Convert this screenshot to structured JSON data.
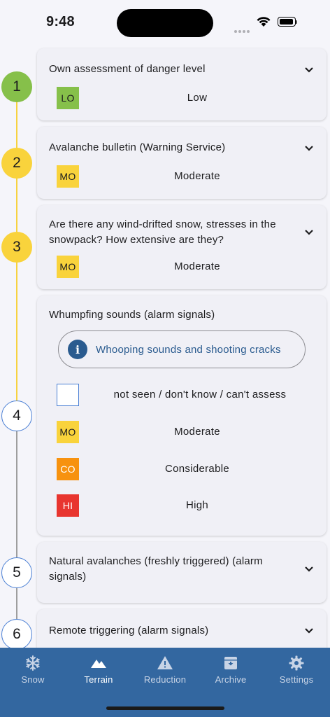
{
  "status": {
    "time": "9:48"
  },
  "steps": [
    "1",
    "2",
    "3",
    "4",
    "5",
    "6"
  ],
  "cards": {
    "c1": {
      "title": "Own assessment of danger level",
      "code": "LO",
      "level": "Low"
    },
    "c2": {
      "title": "Avalanche bulletin (Warning Service)",
      "code": "MO",
      "level": "Moderate"
    },
    "c3": {
      "title": "Are there any wind-drifted snow, stresses in the snowpack? How extensive are they?",
      "code": "MO",
      "level": "Moderate"
    },
    "c4": {
      "title": "Whumpfing sounds (alarm signals)",
      "info": "Whooping sounds and shooting cracks",
      "options": [
        {
          "code": "",
          "label": "not seen / don't know / can't assess"
        },
        {
          "code": "MO",
          "label": "Moderate"
        },
        {
          "code": "CO",
          "label": "Considerable"
        },
        {
          "code": "HI",
          "label": "High"
        }
      ]
    },
    "c5": {
      "title": "Natural avalanches (freshly triggered) (alarm signals)"
    },
    "c6": {
      "title": "Remote triggering (alarm signals)"
    }
  },
  "colors": {
    "low": "#86c04a",
    "moderate": "#f9d33c",
    "considerable": "#f7920f",
    "high": "#e8352f",
    "nav": "#3367a0"
  },
  "nav": [
    {
      "label": "Snow",
      "icon": "snowflake-icon",
      "active": false
    },
    {
      "label": "Terrain",
      "icon": "mountain-icon",
      "active": true
    },
    {
      "label": "Reduction",
      "icon": "warning-icon",
      "active": false
    },
    {
      "label": "Archive",
      "icon": "archive-icon",
      "active": false
    },
    {
      "label": "Settings",
      "icon": "gear-icon",
      "active": false
    }
  ]
}
